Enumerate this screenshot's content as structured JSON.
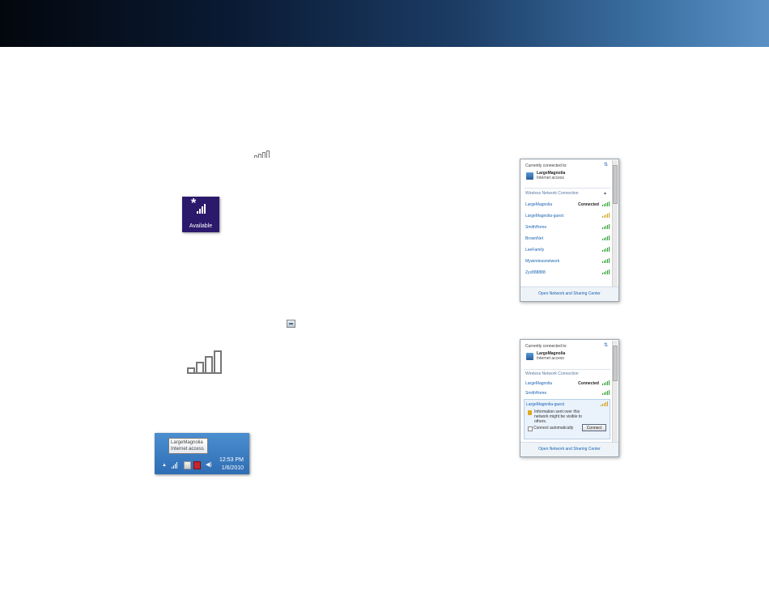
{
  "colors": {
    "header_dark": "#03070d",
    "header_light": "#5a90c4",
    "tile_purple": "#2b1a6b",
    "link_blue": "#1b62b3",
    "signal_green": "#27a12a"
  },
  "available_tile": {
    "label": "Available"
  },
  "taskbar": {
    "tooltip_name": "LargeMagnolia",
    "tooltip_status": "Internet access",
    "time": "12:53 PM",
    "date": "1/6/2010"
  },
  "panel1": {
    "currently_connected": "Currently connected to:",
    "connected_name": "LargeMagnolia",
    "connected_status": "Internet access",
    "section": "Wireless Network Connection",
    "networks": [
      {
        "name": "LargeMagnolia",
        "status": "Connected",
        "signal": 5
      },
      {
        "name": "LargeMagnolia-guest",
        "status": "",
        "signal": 5,
        "secured": true
      },
      {
        "name": "SmithHome",
        "status": "",
        "signal": 5
      },
      {
        "name": "BrownNet",
        "status": "",
        "signal": 5
      },
      {
        "name": "LeeFamily",
        "status": "",
        "signal": 5
      },
      {
        "name": "Mywirelessnetwork",
        "status": "",
        "signal": 5
      },
      {
        "name": "Zyx888888",
        "status": "",
        "signal": 5
      }
    ],
    "footer": "Open Network and Sharing Center"
  },
  "panel2": {
    "currently_connected": "Currently connected to:",
    "connected_name": "LargeMagnolia",
    "connected_status": "Internet access",
    "section": "Wireless Network Connection",
    "networks": [
      {
        "name": "LargeMagnolia",
        "status": "Connected",
        "signal": 5
      },
      {
        "name": "SmithHome",
        "status": "",
        "signal": 5
      }
    ],
    "selected_network": "LargeMagnolia-guest",
    "info_text": "Information sent over this network might be visible to others.",
    "connect_automatically": "Connect automatically",
    "connect_button": "Connect",
    "footer": "Open Network and Sharing Center"
  }
}
